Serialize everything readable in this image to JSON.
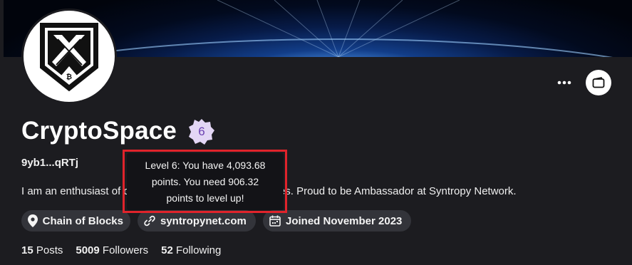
{
  "profile": {
    "name": "CryptoSpace",
    "level": "6",
    "address": "9yb1...qRTj",
    "bio": "I am an enthusiast of crypto and all the new technologies. Proud to be Ambassador at Syntropy Network."
  },
  "chips": {
    "location": "Chain of Blocks",
    "website": "syntropynet.com",
    "joined": "Joined November 2023"
  },
  "stats": {
    "posts_count": "15",
    "posts_label": "Posts",
    "followers_count": "5009",
    "followers_label": "Followers",
    "following_count": "52",
    "following_label": "Following"
  },
  "tooltip": {
    "line1": "Level 6: You have 4,093.68",
    "line2": "points. You need 906.32",
    "line3": "points to level up!"
  },
  "icons": {
    "more": "more-horizontal-icon",
    "wallet": "wallet-icon",
    "location": "map-pin-icon",
    "link": "link-icon",
    "calendar": "calendar-icon"
  },
  "colors": {
    "background": "#1c1c20",
    "chip": "#33343a",
    "badge_fill": "#e3d6f5",
    "badge_text": "#6a3fb0",
    "highlight": "#e0232b"
  }
}
